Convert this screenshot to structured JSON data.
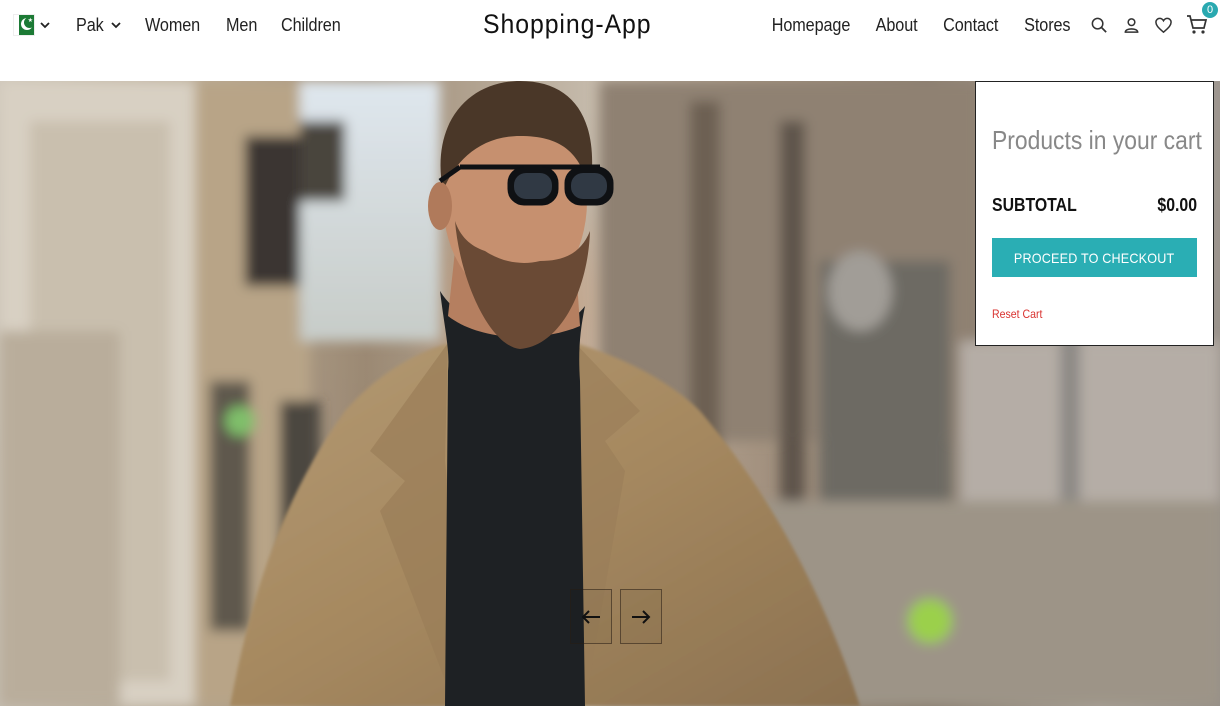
{
  "header": {
    "flag_icon": "pakistan-flag-icon",
    "language": "Pak",
    "left_links": [
      "Women",
      "Men",
      "Children"
    ],
    "brand": "Shopping-App",
    "right_links": [
      "Homepage",
      "About",
      "Contact",
      "Stores"
    ],
    "icons": [
      "search-icon",
      "user-icon",
      "heart-icon",
      "cart-icon"
    ],
    "cart_count": "0"
  },
  "cart": {
    "title": "Products in your cart",
    "subtotal_label": "SUBTOTAL",
    "subtotal_value": "$0.00",
    "checkout_label": "PROCEED TO CHECKOUT",
    "reset_label": "Reset Cart"
  },
  "slider": {
    "prev_icon": "arrow-left-icon",
    "next_icon": "arrow-right-icon"
  },
  "colors": {
    "accent": "#2aaeb4",
    "reset": "#d9322f",
    "flag_green": "#1c7a35"
  }
}
